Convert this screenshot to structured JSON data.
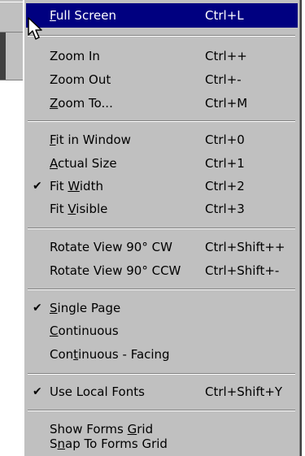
{
  "menu": {
    "items": [
      {
        "label_pre": "",
        "mn": "F",
        "label_post": "ull Screen",
        "shortcut": "Ctrl+L",
        "checked": false,
        "selected": true
      },
      {
        "label_pre": "Zoom In",
        "mn": "",
        "label_post": "",
        "shortcut": "Ctrl++",
        "checked": false
      },
      {
        "label_pre": "Zoom Out",
        "mn": "",
        "label_post": "",
        "shortcut": "Ctrl+-",
        "checked": false
      },
      {
        "label_pre": "",
        "mn": "Z",
        "label_post": "oom To...",
        "shortcut": "Ctrl+M",
        "checked": false
      },
      {
        "label_pre": "",
        "mn": "F",
        "label_post": "it in Window",
        "shortcut": "Ctrl+0",
        "checked": false
      },
      {
        "label_pre": "",
        "mn": "A",
        "label_post": "ctual Size",
        "shortcut": "Ctrl+1",
        "checked": false
      },
      {
        "label_pre": "Fit ",
        "mn": "W",
        "label_post": "idth",
        "shortcut": "Ctrl+2",
        "checked": true
      },
      {
        "label_pre": "Fit ",
        "mn": "V",
        "label_post": "isible",
        "shortcut": "Ctrl+3",
        "checked": false
      },
      {
        "label_pre": "Rotate View 90° CW",
        "mn": "",
        "label_post": "",
        "shortcut": "Ctrl+Shift++",
        "checked": false
      },
      {
        "label_pre": "Rotate View 90° CCW",
        "mn": "",
        "label_post": "",
        "shortcut": "Ctrl+Shift+-",
        "checked": false
      },
      {
        "label_pre": "",
        "mn": "S",
        "label_post": "ingle Page",
        "shortcut": "",
        "checked": true
      },
      {
        "label_pre": "",
        "mn": "C",
        "label_post": "ontinuous",
        "shortcut": "",
        "checked": false
      },
      {
        "label_pre": "Con",
        "mn": "t",
        "label_post": "inuous - Facing",
        "shortcut": "",
        "checked": false
      },
      {
        "label_pre": "Use Local Fonts",
        "mn": "",
        "label_post": "",
        "shortcut": "Ctrl+Shift+Y",
        "checked": true
      },
      {
        "label_pre": "Show Forms ",
        "mn": "G",
        "label_post": "rid",
        "shortcut": "",
        "checked": false
      },
      {
        "label_pre": "S",
        "mn": "n",
        "label_post": "ap To Forms Grid",
        "shortcut": "",
        "checked": false
      }
    ],
    "checkmark": "✔"
  },
  "colors": {
    "menu_bg": "#c0c0c0",
    "highlight": "#000080"
  },
  "icons": {
    "cursor": "arrow-cursor-icon",
    "check": "checkmark-icon"
  }
}
